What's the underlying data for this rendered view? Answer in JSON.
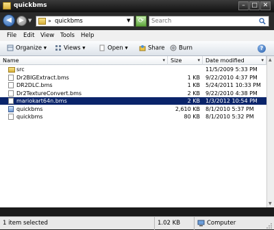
{
  "window": {
    "title": "quickbms"
  },
  "address": {
    "path": "quickbms",
    "separator": "»"
  },
  "search": {
    "placeholder": "Search"
  },
  "menu": [
    "File",
    "Edit",
    "View",
    "Tools",
    "Help"
  ],
  "toolbar": {
    "organize": "Organize",
    "views": "Views",
    "open": "Open",
    "share": "Share",
    "burn": "Burn"
  },
  "columns": {
    "name": "Name",
    "size": "Size",
    "date": "Date modified"
  },
  "files": [
    {
      "name": "src",
      "size": "",
      "date": "11/5/2009 5:33 PM",
      "icon": "folder-icon"
    },
    {
      "name": "Dr2BIGExtract.bms",
      "size": "1 KB",
      "date": "9/22/2010 4:37 PM",
      "icon": "document-icon"
    },
    {
      "name": "DR2DLC.bms",
      "size": "1 KB",
      "date": "5/24/2011 10:33 PM",
      "icon": "document-icon"
    },
    {
      "name": "Dr2TextureConvert.bms",
      "size": "2 KB",
      "date": "9/22/2010 4:38 PM",
      "icon": "document-icon"
    },
    {
      "name": "mariokart64n.bms",
      "size": "2 KB",
      "date": "1/3/2012 10:54 PM",
      "icon": "document-icon",
      "selected": true
    },
    {
      "name": "quickbms",
      "size": "2,610 KB",
      "date": "8/1/2010 5:37 PM",
      "icon": "exe-icon"
    },
    {
      "name": "quickbms",
      "size": "80 KB",
      "date": "8/1/2010 5:32 PM",
      "icon": "batch-file-icon"
    }
  ],
  "status": {
    "selection": "1 item selected",
    "size": "1.02 KB",
    "location": "Computer"
  }
}
